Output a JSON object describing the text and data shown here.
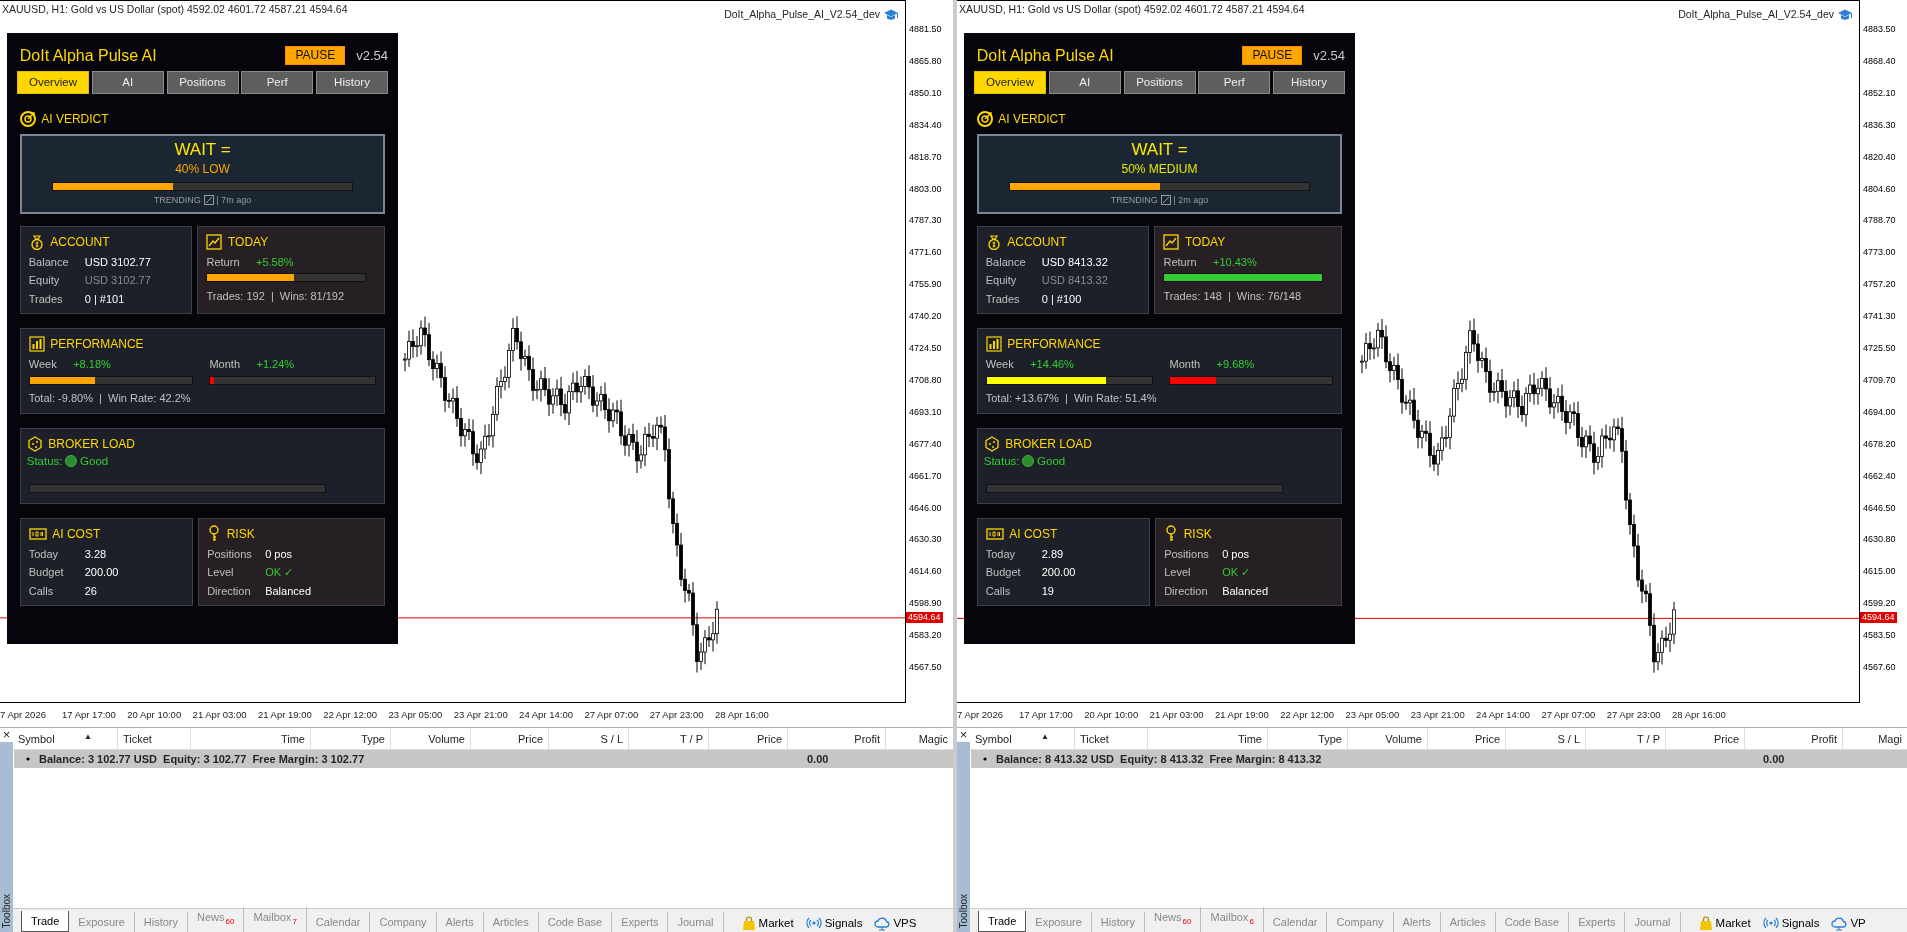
{
  "windows": [
    {
      "chart_title": "XAUUSD, H1:  Gold vs US Dollar (spot)  4592.02 4601.72 4587.21 4594.64",
      "ea_label": "DoIt_Alpha_Pulse_AI_V2.54_dev",
      "price_axis": [
        "4881.50",
        "4865.80",
        "4850.10",
        "4834.40",
        "4818.70",
        "4803.00",
        "4787.30",
        "4771.60",
        "4755.90",
        "4740.20",
        "4724.50",
        "4708.80",
        "4693.10",
        "4677.40",
        "4661.70",
        "4646.00",
        "4630.30",
        "4614.60",
        "4598.90",
        "4583.20",
        "4567.50"
      ],
      "current_price": "4594.64",
      "time_axis": [
        "7 Apr 2026",
        "17 Apr 17:00",
        "20 Apr 10:00",
        "21 Apr 03:00",
        "21 Apr 19:00",
        "22 Apr 12:00",
        "23 Apr 05:00",
        "23 Apr 21:00",
        "24 Apr 14:00",
        "27 Apr 07:00",
        "27 Apr 23:00",
        "28 Apr 16:00"
      ],
      "panel": {
        "title": "DoIt Alpha Pulse AI",
        "pause_button": "PAUSE",
        "version": "v2.54",
        "tabs": [
          {
            "label": "Overview",
            "selected": true
          },
          {
            "label": "AI",
            "selected": false
          },
          {
            "label": "Positions",
            "selected": false
          },
          {
            "label": "Perf",
            "selected": false
          },
          {
            "label": "History",
            "selected": false
          }
        ],
        "verdict": {
          "heading": "AI VERDICT",
          "signal": "WAIT =",
          "confidence": "40% LOW",
          "color": "#ffa500",
          "level": 0.4,
          "regime": "TRENDING",
          "age": "| 7m ago"
        },
        "account": {
          "heading": "ACCOUNT",
          "rows": [
            {
              "label": "Balance",
              "value": "USD 3102.77",
              "dimmed": false
            },
            {
              "label": "Equity",
              "value": "USD 3102.77",
              "dimmed": true
            },
            {
              "label": "Trades",
              "value": "0 | #101",
              "dimmed": false
            }
          ]
        },
        "today": {
          "heading": "TODAY",
          "label": "Return",
          "value": "+5.58%",
          "level": 0.55,
          "color": "#ffa500",
          "summary": "Trades: 192  |  Wins: 81/192"
        },
        "performance": {
          "heading": "PERFORMANCE",
          "metrics": [
            {
              "label": "Week",
              "value": "+8.18%",
              "level": 0.4,
              "color": "#ffa500"
            },
            {
              "label": "Month",
              "value": "+1.24%",
              "level": 0.02,
              "color": "#ff0000"
            }
          ],
          "summary": "Total: -9.80%  |  Win Rate: 42.2%"
        },
        "broker_load": {
          "heading": "BROKER LOAD",
          "status_label": "Status:",
          "status": "Good"
        },
        "ai_cost": {
          "heading": "AI COST",
          "rows": [
            {
              "label": "Today",
              "value": "3.28"
            },
            {
              "label": "Budget",
              "value": "200.00"
            },
            {
              "label": "Calls",
              "value": "26"
            }
          ]
        },
        "risk": {
          "heading": "RISK",
          "rows": [
            {
              "label": "Positions",
              "value": "0 pos",
              "color": "#ffffff"
            },
            {
              "label": "Level",
              "value": "OK ✓",
              "color": "#32cd32"
            },
            {
              "label": "Direction",
              "value": "Balanced",
              "color": "#ffffff"
            }
          ]
        }
      },
      "toolbox": {
        "close": "×",
        "side_label": "Toolbox",
        "sort_mark": "▲",
        "columns": [
          "Symbol",
          "Ticket",
          "Time",
          "Type",
          "Volume",
          "Price",
          "S / L",
          "T / P",
          "Price",
          "Profit",
          "Magic"
        ],
        "balance_row": {
          "summary": "Balance: 3 102.77 USD  Equity: 3 102.77  Free Margin: 3 102.77",
          "profit": "0.00"
        },
        "tabs": [
          {
            "label": "Trade",
            "selected": true
          },
          {
            "label": "Exposure",
            "selected": false
          },
          {
            "label": "History",
            "selected": false
          },
          {
            "label": "News",
            "badge": "60",
            "selected": false
          },
          {
            "label": "Mailbox",
            "badge": "7",
            "selected": false
          },
          {
            "label": "Calendar",
            "selected": false
          },
          {
            "label": "Company",
            "selected": false
          },
          {
            "label": "Alerts",
            "selected": false
          },
          {
            "label": "Articles",
            "selected": false
          },
          {
            "label": "Code Base",
            "selected": false
          },
          {
            "label": "Experts",
            "selected": false
          },
          {
            "label": "Journal",
            "selected": false
          }
        ],
        "shortcuts": [
          {
            "label": "Market",
            "kind": "market"
          },
          {
            "label": "Signals",
            "kind": "signals"
          },
          {
            "label": "VPS",
            "kind": "vps"
          }
        ]
      }
    },
    {
      "chart_title": "XAUUSD, H1:  Gold vs US Dollar (spot)  4592.02 4601.72 4587.21 4594.64",
      "ea_label": "DoIt_Alpha_Pulse_AI_V2.54_dev",
      "price_axis": [
        "4883.50",
        "4868.40",
        "4852.10",
        "4836.30",
        "4820.40",
        "4804.60",
        "4788.70",
        "4773.00",
        "4757.20",
        "4741.30",
        "4725.50",
        "4709.70",
        "4694.00",
        "4678.20",
        "4662.40",
        "4646.50",
        "4630.80",
        "4615.00",
        "4599.20",
        "4583.50",
        "4567.60"
      ],
      "current_price": "4594.64",
      "time_axis": [
        "7 Apr 2026",
        "17 Apr 17:00",
        "20 Apr 10:00",
        "21 Apr 03:00",
        "21 Apr 19:00",
        "22 Apr 12:00",
        "23 Apr 05:00",
        "23 Apr 21:00",
        "24 Apr 14:00",
        "27 Apr 07:00",
        "27 Apr 23:00",
        "28 Apr 16:00"
      ],
      "panel": {
        "title": "DoIt Alpha Pulse AI",
        "pause_button": "PAUSE",
        "version": "v2.54",
        "tabs": [
          {
            "label": "Overview",
            "selected": true
          },
          {
            "label": "AI",
            "selected": false
          },
          {
            "label": "Positions",
            "selected": false
          },
          {
            "label": "Perf",
            "selected": false
          },
          {
            "label": "History",
            "selected": false
          }
        ],
        "verdict": {
          "heading": "AI VERDICT",
          "signal": "WAIT =",
          "confidence": "50% MEDIUM",
          "color": "#e6e600",
          "level": 0.5,
          "regime": "TRENDING",
          "age": "| 2m ago"
        },
        "account": {
          "heading": "ACCOUNT",
          "rows": [
            {
              "label": "Balance",
              "value": "USD 8413.32",
              "dimmed": false
            },
            {
              "label": "Equity",
              "value": "USD 8413.32",
              "dimmed": true
            },
            {
              "label": "Trades",
              "value": "0 | #100",
              "dimmed": false
            }
          ]
        },
        "today": {
          "heading": "TODAY",
          "label": "Return",
          "value": "+10.43%",
          "level": 1,
          "color": "#32cd32",
          "summary": "Trades: 148  |  Wins: 76/148"
        },
        "performance": {
          "heading": "PERFORMANCE",
          "metrics": [
            {
              "label": "Week",
              "value": "+14.46%",
              "level": 0.72,
              "color": "#ffff00"
            },
            {
              "label": "Month",
              "value": "+9.68%",
              "level": 0.28,
              "color": "#ff0000"
            }
          ],
          "summary": "Total: +13.67%  |  Win Rate: 51.4%"
        },
        "broker_load": {
          "heading": "BROKER LOAD",
          "status_label": "Status:",
          "status": "Good"
        },
        "ai_cost": {
          "heading": "AI COST",
          "rows": [
            {
              "label": "Today",
              "value": "2.89"
            },
            {
              "label": "Budget",
              "value": "200.00"
            },
            {
              "label": "Calls",
              "value": "19"
            }
          ]
        },
        "risk": {
          "heading": "RISK",
          "rows": [
            {
              "label": "Positions",
              "value": "0 pos",
              "color": "#ffffff"
            },
            {
              "label": "Level",
              "value": "OK ✓",
              "color": "#32cd32"
            },
            {
              "label": "Direction",
              "value": "Balanced",
              "color": "#ffffff"
            }
          ]
        }
      },
      "toolbox": {
        "close": "×",
        "side_label": "Toolbox",
        "sort_mark": "▲",
        "columns": [
          "Symbol",
          "Ticket",
          "Time",
          "Type",
          "Volume",
          "Price",
          "S / L",
          "T / P",
          "Price",
          "Profit",
          "Magi"
        ],
        "balance_row": {
          "summary": "Balance: 8 413.32 USD  Equity: 8 413.32  Free Margin: 8 413.32",
          "profit": "0.00"
        },
        "tabs": [
          {
            "label": "Trade",
            "selected": true
          },
          {
            "label": "Exposure",
            "selected": false
          },
          {
            "label": "History",
            "selected": false
          },
          {
            "label": "News",
            "badge": "60",
            "selected": false
          },
          {
            "label": "Mailbox",
            "badge": "6",
            "selected": false
          },
          {
            "label": "Calendar",
            "selected": false
          },
          {
            "label": "Company",
            "selected": false
          },
          {
            "label": "Alerts",
            "selected": false
          },
          {
            "label": "Articles",
            "selected": false
          },
          {
            "label": "Code Base",
            "selected": false
          },
          {
            "label": "Experts",
            "selected": false
          },
          {
            "label": "Journal",
            "selected": false
          }
        ],
        "shortcuts": [
          {
            "label": "Market",
            "kind": "market"
          },
          {
            "label": "Signals",
            "kind": "signals"
          },
          {
            "label": "VP",
            "kind": "vps"
          }
        ]
      }
    }
  ]
}
